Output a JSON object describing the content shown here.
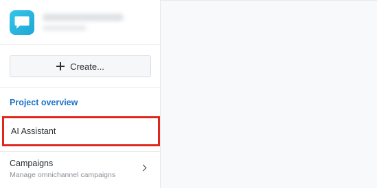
{
  "sidebar": {
    "create_button_label": "Create...",
    "nav": {
      "project_overview": "Project overview",
      "ai_assistant": "AI Assistant",
      "campaigns": {
        "label": "Campaigns",
        "description": "Manage omnichannel campaigns"
      }
    }
  },
  "icons": {
    "logo": "chat-bubble-icon",
    "create": "plus-icon",
    "campaigns": "chevron-right-icon"
  },
  "colors": {
    "accent_link": "#1a73c9",
    "highlight_border": "#e0261c",
    "logo_gradient_start": "#34c5e8",
    "logo_gradient_end": "#1fa7d6"
  }
}
